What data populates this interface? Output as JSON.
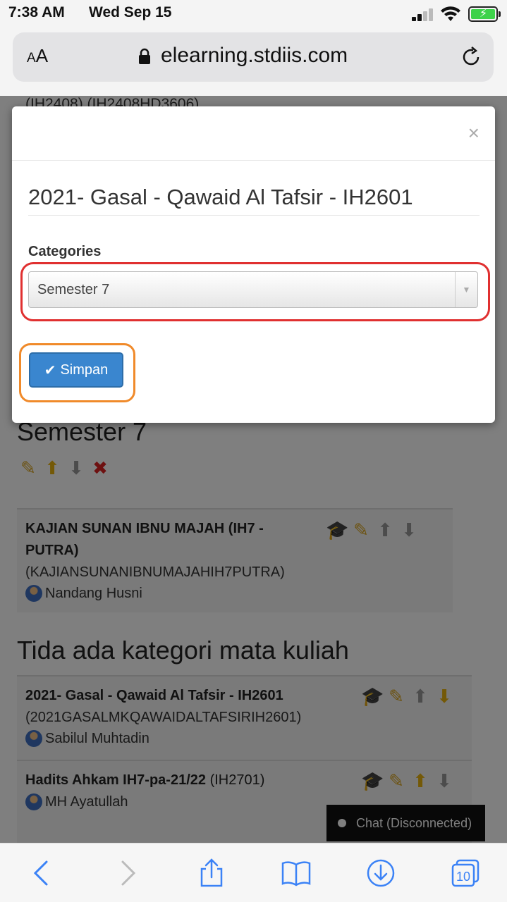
{
  "status_bar": {
    "time": "7:38 AM",
    "date": "Wed Sep 15"
  },
  "url_bar": {
    "aa_small": "A",
    "aa_large": "A",
    "url": "elearning.stdiis.com"
  },
  "page": {
    "top_cut_text": "(IH2408) (IH2408HD3606)",
    "semester_heading": "Semester 7",
    "semester_course": {
      "title_line1": "KAJIAN SUNAN IBNU MAJAH (IH7 -",
      "title_line2": "PUTRA)",
      "code": "(KAJIANSUNANIBNUMAJAHIH7PUTRA)",
      "teacher": "Nandang Husni"
    },
    "no_category_heading": "Tida ada kategori mata kuliah",
    "courses": [
      {
        "title": "2021- Gasal - Qawaid Al Tafsir - IH2601",
        "code": "(2021GASALMKQAWAIDALTAFSIRIH2601)",
        "teacher": "Sabilul Muhtadin"
      },
      {
        "title": "Hadits Ahkam IH7-pa-21/22",
        "code": "(IH2701)",
        "teacher": "MH Ayatullah"
      }
    ],
    "chat_label": "Chat (Disconnected)"
  },
  "modal": {
    "close_glyph": "×",
    "title": "2021- Gasal - Qawaid Al Tafsir - IH2601",
    "categories_label": "Categories",
    "categories_selected": "Semester 7",
    "save_label": "Simpan"
  },
  "toolbar": {
    "tabs_count": "10"
  },
  "colors": {
    "accent": "#3a86cf",
    "highlight_red": "#e03030",
    "highlight_orange": "#f08a2a",
    "ios_blue": "#3b82f6"
  }
}
